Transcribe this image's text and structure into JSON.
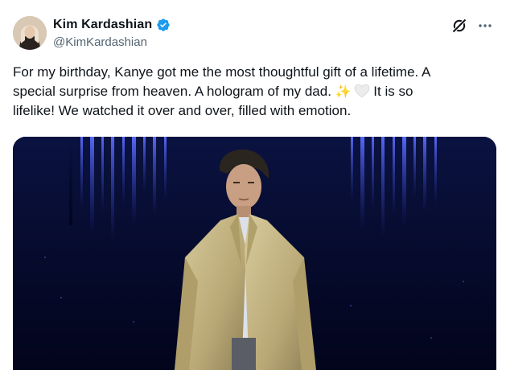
{
  "author": {
    "display_name": "Kim Kardashian",
    "handle": "@KimKardashian",
    "verified": true,
    "verified_color": "#1d9bf0"
  },
  "tweet": {
    "text_line1": "For my birthday, Kanye got me the most thoughtful gift of a lifetime. A",
    "text_line2_a": "special surprise from heaven. A hologram of my dad. ",
    "emoji_sparkles": "✨",
    "emoji_white_heart": "🤍",
    "text_line2_b": " It is so",
    "text_line3": "lifelike! We watched it over and over, filled with emotion."
  },
  "icons": {
    "verified": "verified-badge-icon",
    "grok": "grok-icon",
    "more": "more-options-icon"
  },
  "media": {
    "kind": "video-still",
    "description_colors": {
      "background": "#050a28",
      "light_beams": "#3b4fd8",
      "jacket": "#c9b98a"
    }
  }
}
